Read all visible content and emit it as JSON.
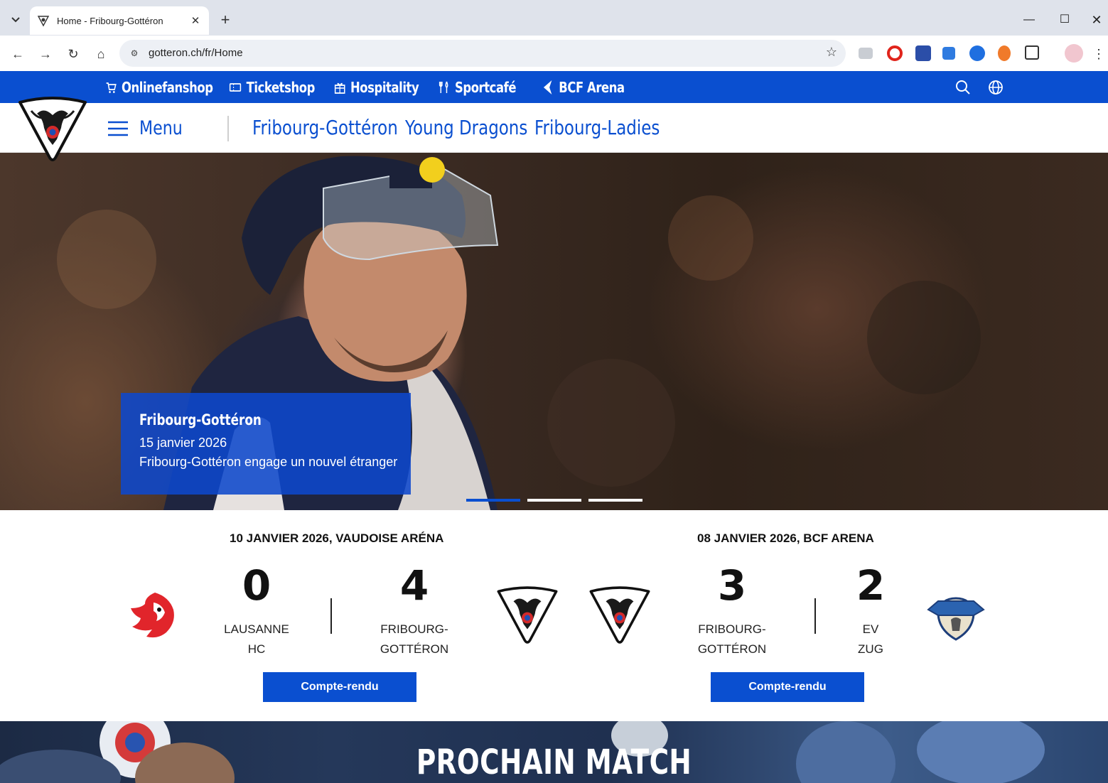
{
  "browser": {
    "tab_title": "Home - Fribourg-Gottéron",
    "url": "gotteron.ch/fr/Home"
  },
  "topbar": {
    "links": [
      "Onlinefanshop",
      "Ticketshop",
      "Hospitality",
      "Sportcafé",
      "BCF Arena"
    ]
  },
  "mainnav": {
    "menu_label": "Menu",
    "links": [
      "Fribourg-Gottéron",
      "Young Dragons",
      "Fribourg-Ladies"
    ]
  },
  "hero": {
    "category": "Fribourg-Gottéron",
    "date": "15 janvier 2026",
    "headline": "Fribourg-Gottéron engage un nouvel étranger",
    "slides": 3,
    "active_slide": 1
  },
  "results": [
    {
      "heading": "10 JANVIER 2026, VAUDOISE ARÉNA",
      "home_team_line1": "LAUSANNE",
      "home_team_line2": "HC",
      "home_score": "0",
      "away_team_line1": "FRIBOURG-",
      "away_team_line2": "GOTTÉRON",
      "away_score": "4",
      "button": "Compte-rendu"
    },
    {
      "heading": "08 JANVIER 2026, BCF ARENA",
      "home_team_line1": "FRIBOURG-",
      "home_team_line2": "GOTTÉRON",
      "home_score": "3",
      "away_team_line1": "EV",
      "away_team_line2": "ZUG",
      "away_score": "2",
      "button": "Compte-rendu"
    }
  ],
  "next_match": {
    "title": "PROCHAIN MATCH"
  },
  "colors": {
    "brand_blue": "#0a4fd0",
    "text_dark": "#111111"
  }
}
